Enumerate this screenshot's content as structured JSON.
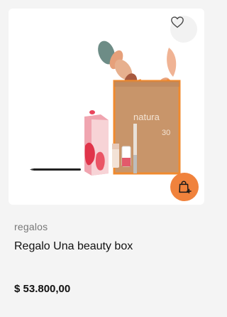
{
  "product": {
    "image_alt": "Regalo Una beauty box",
    "bag_brand": "natura",
    "bag_badge": "30",
    "category": "regalos",
    "title": "Regalo Una beauty box",
    "price": "$ 53.800,00"
  },
  "actions": {
    "favorite_icon": "heart-outline-icon",
    "cart_icon": "bag-add-icon"
  },
  "colors": {
    "accent": "#f0823c",
    "background": "#f4f4f4"
  }
}
